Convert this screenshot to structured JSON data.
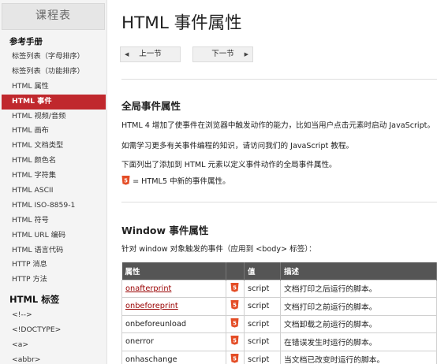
{
  "sidebar": {
    "title": "课程表",
    "section1": "参考手册",
    "items": [
      {
        "label": "标签列表（字母排序）",
        "active": false
      },
      {
        "label": "标签列表（功能排序）",
        "active": false
      },
      {
        "label": "HTML 属性",
        "active": false
      },
      {
        "label": "HTML 事件",
        "active": true
      },
      {
        "label": "HTML 视频/音频",
        "active": false
      },
      {
        "label": "HTML 画布",
        "active": false
      },
      {
        "label": "HTML 文档类型",
        "active": false
      },
      {
        "label": "HTML 颜色名",
        "active": false
      },
      {
        "label": "HTML 字符集",
        "active": false
      },
      {
        "label": "HTML ASCII",
        "active": false
      },
      {
        "label": "HTML ISO-8859-1",
        "active": false
      },
      {
        "label": "HTML 符号",
        "active": false
      },
      {
        "label": "HTML URL 编码",
        "active": false
      },
      {
        "label": "HTML 语言代码",
        "active": false
      },
      {
        "label": "HTTP 消息",
        "active": false
      },
      {
        "label": "HTTP 方法",
        "active": false
      }
    ],
    "section2": "HTML 标签",
    "tags": [
      "<!-->",
      "<!DOCTYPE>",
      "<a>",
      "<abbr>"
    ]
  },
  "main": {
    "title": "HTML 事件属性",
    "prev_label": "上一节",
    "next_label": "下一节",
    "global_heading": "全局事件属性",
    "para1": "HTML 4 增加了使事件在浏览器中触发动作的能力，比如当用户点击元素时启动 JavaScript。",
    "para2": "如需学习更多有关事件编程的知识，请访问我们的 JavaScript 教程。",
    "para3": "下面列出了添加到 HTML 元素以定义事件动作的全局事件属性。",
    "h5_note": "= HTML5 中新的事件属性。",
    "window_heading": "Window 事件属性",
    "window_desc": "针对 window 对象触发的事件（应用到 <body> 标签）：",
    "table_headers": [
      "属性",
      "",
      "值",
      "描述"
    ],
    "rows": [
      {
        "attr": "onafterprint",
        "link": true,
        "value": "script",
        "desc": "文档打印之后运行的脚本。"
      },
      {
        "attr": "onbeforeprint",
        "link": true,
        "value": "script",
        "desc": "文档打印之前运行的脚本。"
      },
      {
        "attr": "onbeforeunload",
        "link": false,
        "value": "script",
        "desc": "文档卸载之前运行的脚本。"
      },
      {
        "attr": "onerror",
        "link": false,
        "value": "script",
        "desc": "在错误发生时运行的脚本。"
      },
      {
        "attr": "onhaschange",
        "link": false,
        "value": "script",
        "desc": "当文档已改变时运行的脚本。"
      }
    ]
  },
  "colors": {
    "accent": "#c0282d",
    "html5_badge": "#e44d26",
    "table_header": "#555555",
    "link": "#990000"
  }
}
